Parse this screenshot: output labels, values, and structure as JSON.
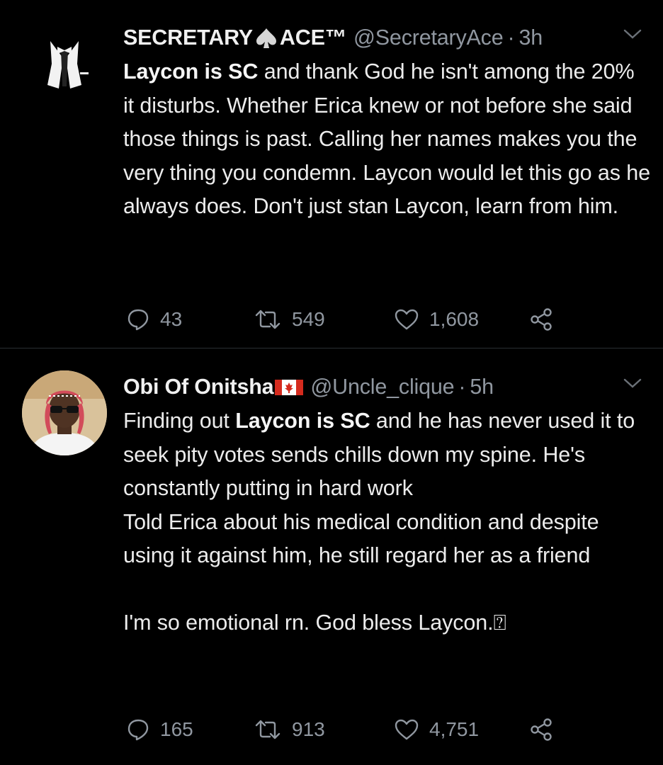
{
  "colors": {
    "background": "#000000",
    "text": "#ececec",
    "secondary": "#9097a0",
    "divider": "#2a2f33"
  },
  "tweets": [
    {
      "author": {
        "name_a": "SECRETARY",
        "name_b": "ACE™",
        "name_symbol": "spade-icon",
        "handle": "@SecretaryAce",
        "time": "3h"
      },
      "body": {
        "bold_1": "Laycon is SC",
        "text_1": " and thank God he isn't among the 20% it disturbs. Whether Erica knew or not before she said those things is past. Calling her names makes you the very thing you condemn. Laycon would let this go as he always does. Don't just stan Laycon, learn from him."
      },
      "stats": {
        "replies": "43",
        "retweets": "549",
        "likes": "1,608"
      }
    },
    {
      "author": {
        "name_a": "Obi Of Onitsha",
        "name_symbol": "canada-flag-icon",
        "handle": "@Uncle_clique",
        "time": "5h"
      },
      "body": {
        "text_0": "Finding out ",
        "bold_1": "Laycon is SC",
        "text_1": " and he has never used it to seek pity votes sends chills down my spine. He's constantly putting in hard work\nTold Erica about his medical condition and despite using it against him, he still regard her as a friend\n\nI'm so emotional rn. God bless Laycon.",
        "trailing_glyph": "⍰"
      },
      "stats": {
        "replies": "165",
        "retweets": "913",
        "likes": "4,751"
      }
    }
  ]
}
